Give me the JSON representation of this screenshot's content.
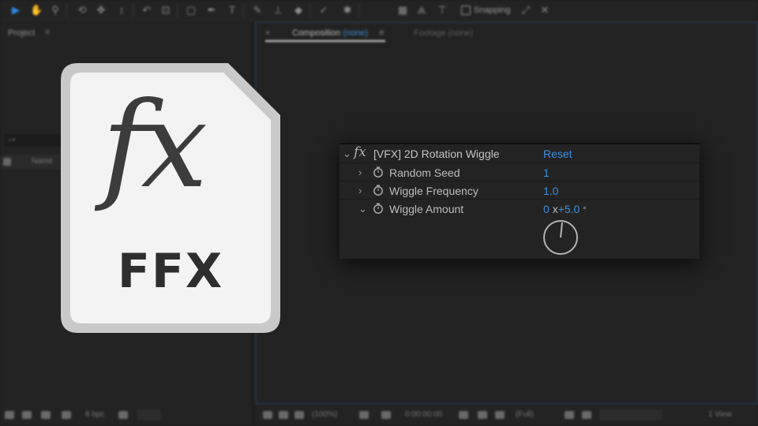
{
  "toolbar": {
    "snapping_label": "Snapping"
  },
  "project_panel": {
    "title": "Project",
    "menu": "≡",
    "search_placeholder": "⌕▾",
    "column_name": "Name"
  },
  "composition_panel": {
    "close": "×",
    "tab_prefix": "Composition",
    "tab_value": "(none)",
    "tab_menu": "≡",
    "footage_tab": "Footage (none)"
  },
  "project_bottom": {
    "bpc": "8 bpc"
  },
  "viewer_bottom": {
    "zoom": "(100%)",
    "time": "0:00:00:00",
    "resolution": "(Full)",
    "view": "1 View"
  },
  "file_icon": {
    "glyph": "fx",
    "label": "FFX"
  },
  "effect_controls": {
    "fx_glyph": "fx",
    "effect_name": "[VFX] 2D Rotation Wiggle",
    "reset_label": "Reset",
    "params": [
      {
        "name": "Random Seed",
        "value": "1",
        "expanded": false
      },
      {
        "name": "Wiggle Frequency",
        "value": "1.0",
        "expanded": false
      },
      {
        "name": "Wiggle Amount",
        "value_revolutions": "0",
        "value_x": "x",
        "value_degrees": "+5.0",
        "degree_symbol": "°",
        "expanded": true
      }
    ]
  },
  "colors": {
    "accent_blue": "#3f8fe0",
    "panel_bg": "#232323",
    "file_icon_fill": "#f3f3f3",
    "file_icon_border": "#c9c9c9"
  }
}
